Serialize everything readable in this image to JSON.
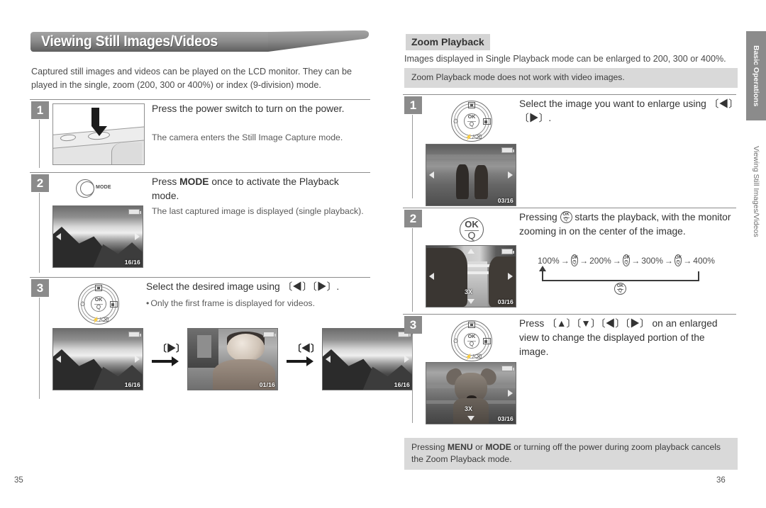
{
  "document": {
    "left_page_number": "35",
    "right_page_number": "36"
  },
  "side_tab": {
    "chapter": "Basic Operations",
    "section": "Viewing Still Images/Videos"
  },
  "left_column": {
    "title": "Viewing Still Images/Videos",
    "intro": "Captured still images and videos can be played on the LCD monitor. They can be played in the single, zoom (200, 300 or 400%) or index (9-division) mode.",
    "steps": [
      {
        "number": "1",
        "title_prefix": "Press the power switch to turn on the ",
        "title_bold": "",
        "title_suffix": "power.",
        "title_plain": "Press the power switch to turn on the power.",
        "sub": "The camera enters the Still Image Capture mode.",
        "figure": "camera-top-power-switch"
      },
      {
        "number": "2",
        "title_before": "Press ",
        "title_bold": "MODE",
        "title_after": " once to activate the Playback mode.",
        "sub": "The last captured image is displayed (single playback).",
        "dial_label": "MODE",
        "lcd_counter": "16/16"
      },
      {
        "number": "3",
        "title_plain": "Select the desired image using 〔◀〕〔▶〕.",
        "sub": "Only the first frame is displayed for videos.",
        "thumbnails": [
          {
            "counter": "16/16",
            "scene": "mountain"
          },
          {
            "counter": "01/16",
            "scene": "baby"
          },
          {
            "counter": "16/16",
            "scene": "mountain"
          }
        ],
        "arrow_labels": [
          "〔▶〕",
          "〔◀〕"
        ]
      }
    ]
  },
  "right_column": {
    "heading": "Zoom Playback",
    "intro": "Images displayed in Single Playback mode can be enlarged to 200, 300 or 400%.",
    "note_top": "Zoom Playback mode does not work with video images.",
    "note_bottom_before": "Pressing ",
    "note_bottom_b1": "MENU",
    "note_bottom_mid": " or ",
    "note_bottom_b2": "MODE",
    "note_bottom_after": " or turning off the power during zoom playback cancels the Zoom Playback mode.",
    "steps": [
      {
        "number": "1",
        "title_plain": "Select the image you want to enlarge using 〔◀〕〔▶〕.",
        "lcd_counter": "03/16"
      },
      {
        "number": "2",
        "title_before": "Pressing ",
        "title_after": " starts the playback, with the monitor zooming in on the center of the image.",
        "lcd_counter": "03/16",
        "lcd_zoom_label": "3X"
      },
      {
        "number": "3",
        "title_plain": "Press 〔▲〕〔▼〕〔◀〕〔▶〕 on an enlarged view to change the displayed portion of the image.",
        "lcd_counter": "03/16",
        "lcd_zoom_label": "3X"
      }
    ],
    "zoom_flow": {
      "steps": [
        "100%",
        "200%",
        "300%",
        "400%"
      ],
      "arrow": "→",
      "button_label": "OK/Q"
    }
  },
  "icons": {
    "ok_top": "OK",
    "ok_bottom": "Q",
    "dpad_left": "⏱",
    "dpad_bottom": "⚡/Ὕ1"
  },
  "colors": {
    "banner": "#8b8b8b",
    "badge": "#8b8b8b",
    "note_bg": "#d9d9d9",
    "heading_bg": "#d4d4d4",
    "text": "#4a4a4a"
  }
}
